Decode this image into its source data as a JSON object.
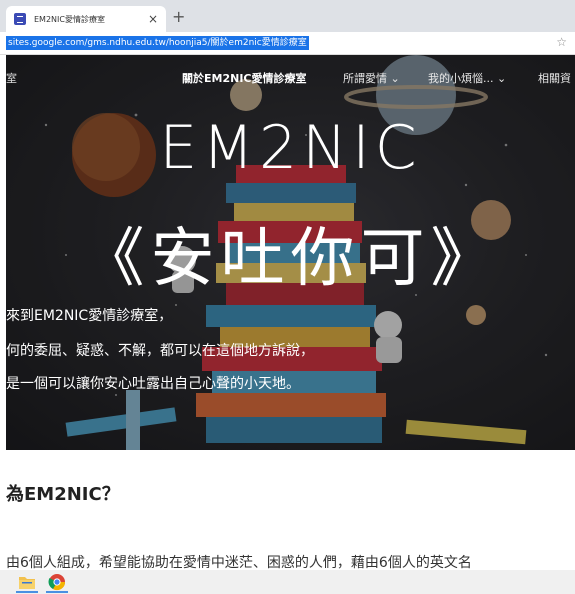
{
  "browser": {
    "tab_title": "EM2NIC愛情診療室",
    "tab_close": "×",
    "new_tab": "+",
    "url": "sites.google.com/gms.ndhu.edu.tw/hoonjia5/關於em2nic愛情診療室",
    "star": "☆"
  },
  "site": {
    "nav_home": "室",
    "nav": [
      {
        "label": "關於EM2NIC愛情診療室"
      },
      {
        "label": "所謂愛情 ⌄"
      },
      {
        "label": "我的小煩惱... ⌄"
      },
      {
        "label": "相關資"
      }
    ],
    "hero_title_en": "EM2NIC",
    "hero_title_zh": "《安吐你可》",
    "intro_lines": [
      "來到EM2NIC愛情診療室，",
      "何的委屈、疑惑、不解，都可以在這個地方訴說，",
      "是一個可以讓你安心吐露出自己心聲的小天地。"
    ]
  },
  "content": {
    "heading": "為EM2NIC？",
    "paragraph": "由6個人組成，希望能協助在愛情中迷茫、困惑的人們，藉由6個人的英文名"
  },
  "taskbar": {
    "icons": [
      "folder-icon",
      "chrome-icon"
    ],
    "accent": "#4a90e2"
  }
}
